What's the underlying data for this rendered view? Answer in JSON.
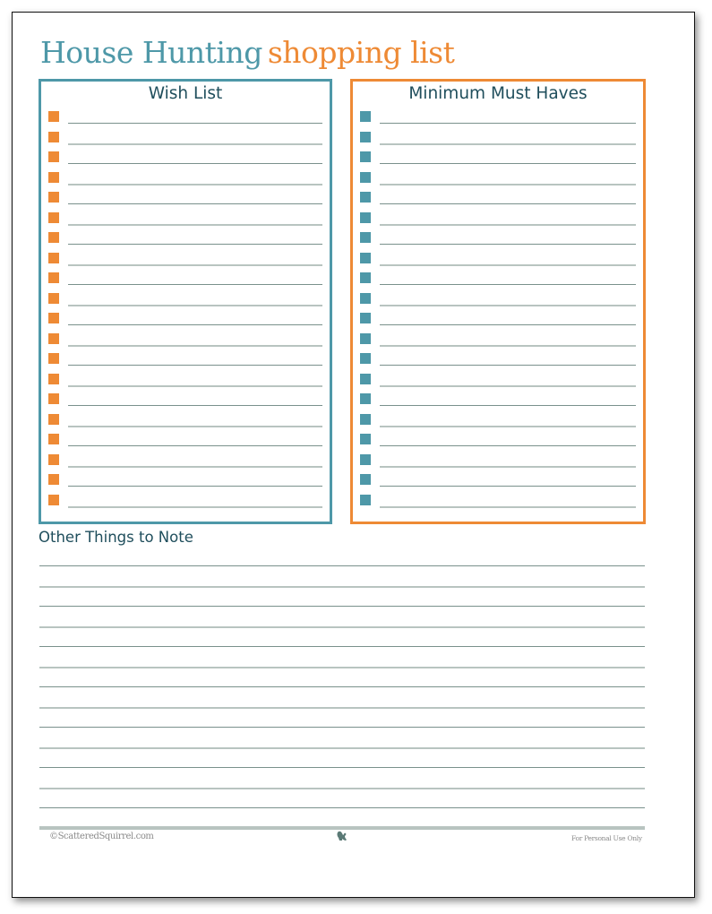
{
  "title": {
    "part1": "House Hunting",
    "part2": "shopping list"
  },
  "colors": {
    "teal": "#4e98a8",
    "orange": "#ee8a35",
    "heading": "#1f4e5c",
    "rule_dark": "#7a918c",
    "rule_light": "#b8c4c0"
  },
  "wish_list": {
    "title": "Wish List",
    "checkbox_icon": "orange-square",
    "items": [
      "",
      "",
      "",
      "",
      "",
      "",
      "",
      "",
      "",
      "",
      "",
      "",
      "",
      "",
      "",
      "",
      "",
      "",
      "",
      ""
    ]
  },
  "must_haves": {
    "title": "Minimum Must Haves",
    "checkbox_icon": "teal-square",
    "items": [
      "",
      "",
      "",
      "",
      "",
      "",
      "",
      "",
      "",
      "",
      "",
      "",
      "",
      "",
      "",
      "",
      "",
      "",
      "",
      ""
    ]
  },
  "notes": {
    "title": "Other Things to Note",
    "lines": [
      "",
      "",
      "",
      "",
      "",
      "",
      "",
      "",
      "",
      "",
      "",
      "",
      "",
      ""
    ]
  },
  "footer": {
    "copyright": "©ScatteredSquirrel.com",
    "icon": "squirrel-icon",
    "notice": "For Personal Use Only"
  }
}
